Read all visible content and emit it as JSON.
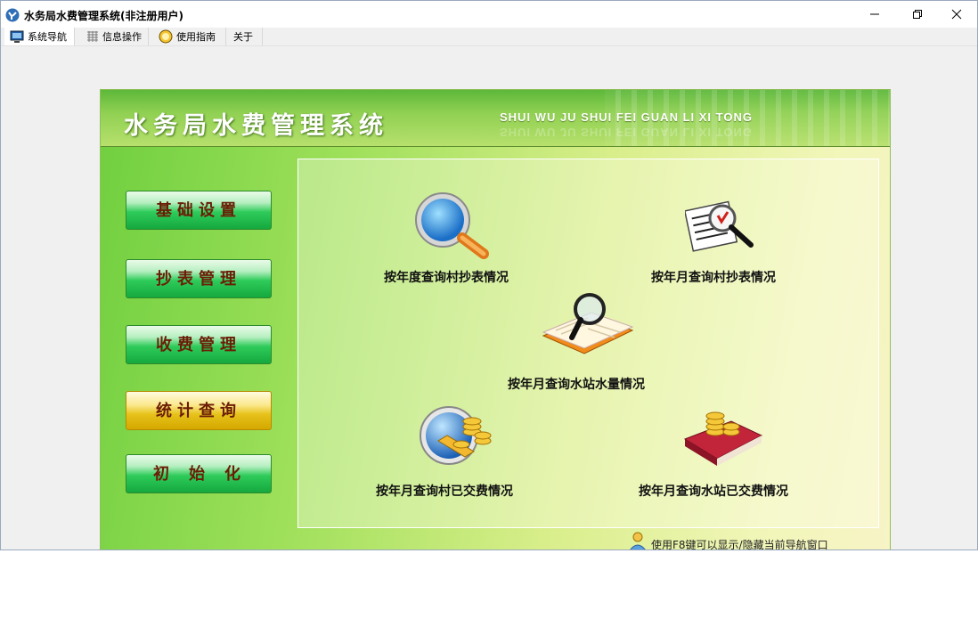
{
  "window": {
    "title": "水务局水费管理系统(非注册用户)"
  },
  "menu": {
    "items": [
      {
        "label": "系统导航",
        "icon": "monitor-icon"
      },
      {
        "label": "信息操作",
        "icon": "grid-icon"
      },
      {
        "label": "使用指南",
        "icon": "guide-icon"
      },
      {
        "label": "关于",
        "icon": ""
      }
    ]
  },
  "header": {
    "title": "水务局水费管理系统",
    "subtitle": "SHUI WU JU SHUI FEI GUAN LI XI TONG"
  },
  "nav": {
    "items": [
      {
        "label": "基础设置",
        "selected": false
      },
      {
        "label": "抄表管理",
        "selected": false
      },
      {
        "label": "收费管理",
        "selected": false
      },
      {
        "label": "统计查询",
        "selected": true
      },
      {
        "label": "初始化",
        "selected": false
      }
    ]
  },
  "queries": [
    {
      "label": "按年度查询村抄表情况",
      "icon": "magnifier-icon"
    },
    {
      "label": "按年月查询村抄表情况",
      "icon": "document-search-icon"
    },
    {
      "label": "按年月查询水站水量情况",
      "icon": "book-search-icon"
    },
    {
      "label": "按年月查询村已交费情况",
      "icon": "globe-coins-icon"
    },
    {
      "label": "按年月查询水站已交费情况",
      "icon": "book-coins-icon"
    }
  ],
  "footer": {
    "tip": "使用F8键可以显示/隐藏当前导航窗口"
  }
}
